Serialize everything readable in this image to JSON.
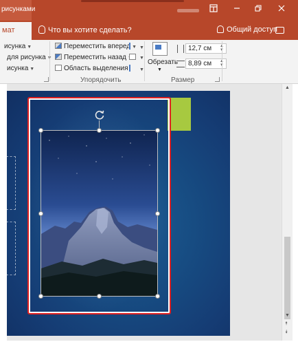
{
  "title_bar": {
    "context_tab": "рисунками",
    "restore_icon": "layout-icon",
    "minimize_icon": "minimize-icon",
    "maximize_icon": "restore-window-icon",
    "close_icon": "close-icon"
  },
  "tabs": {
    "active_tab": "мат",
    "tell_me": "Что вы хотите сделать?",
    "share": "Общий доступ"
  },
  "ribbon": {
    "left_items": [
      "исунка",
      "для рисунка",
      "исунка"
    ],
    "arrange": {
      "bring_forward": "Переместить вперед",
      "send_backward": "Переместить назад",
      "selection_pane": "Область выделения",
      "group_label": "Упорядочить"
    },
    "size": {
      "crop": "Обрезать",
      "height": "12,7 см",
      "width": "8,89 см",
      "group_label": "Размер"
    }
  },
  "colors": {
    "title_bar": "#b7472a",
    "slide_bg": "#174d83",
    "accent_green": "#a7c940",
    "selection_outline": "#e02020"
  }
}
